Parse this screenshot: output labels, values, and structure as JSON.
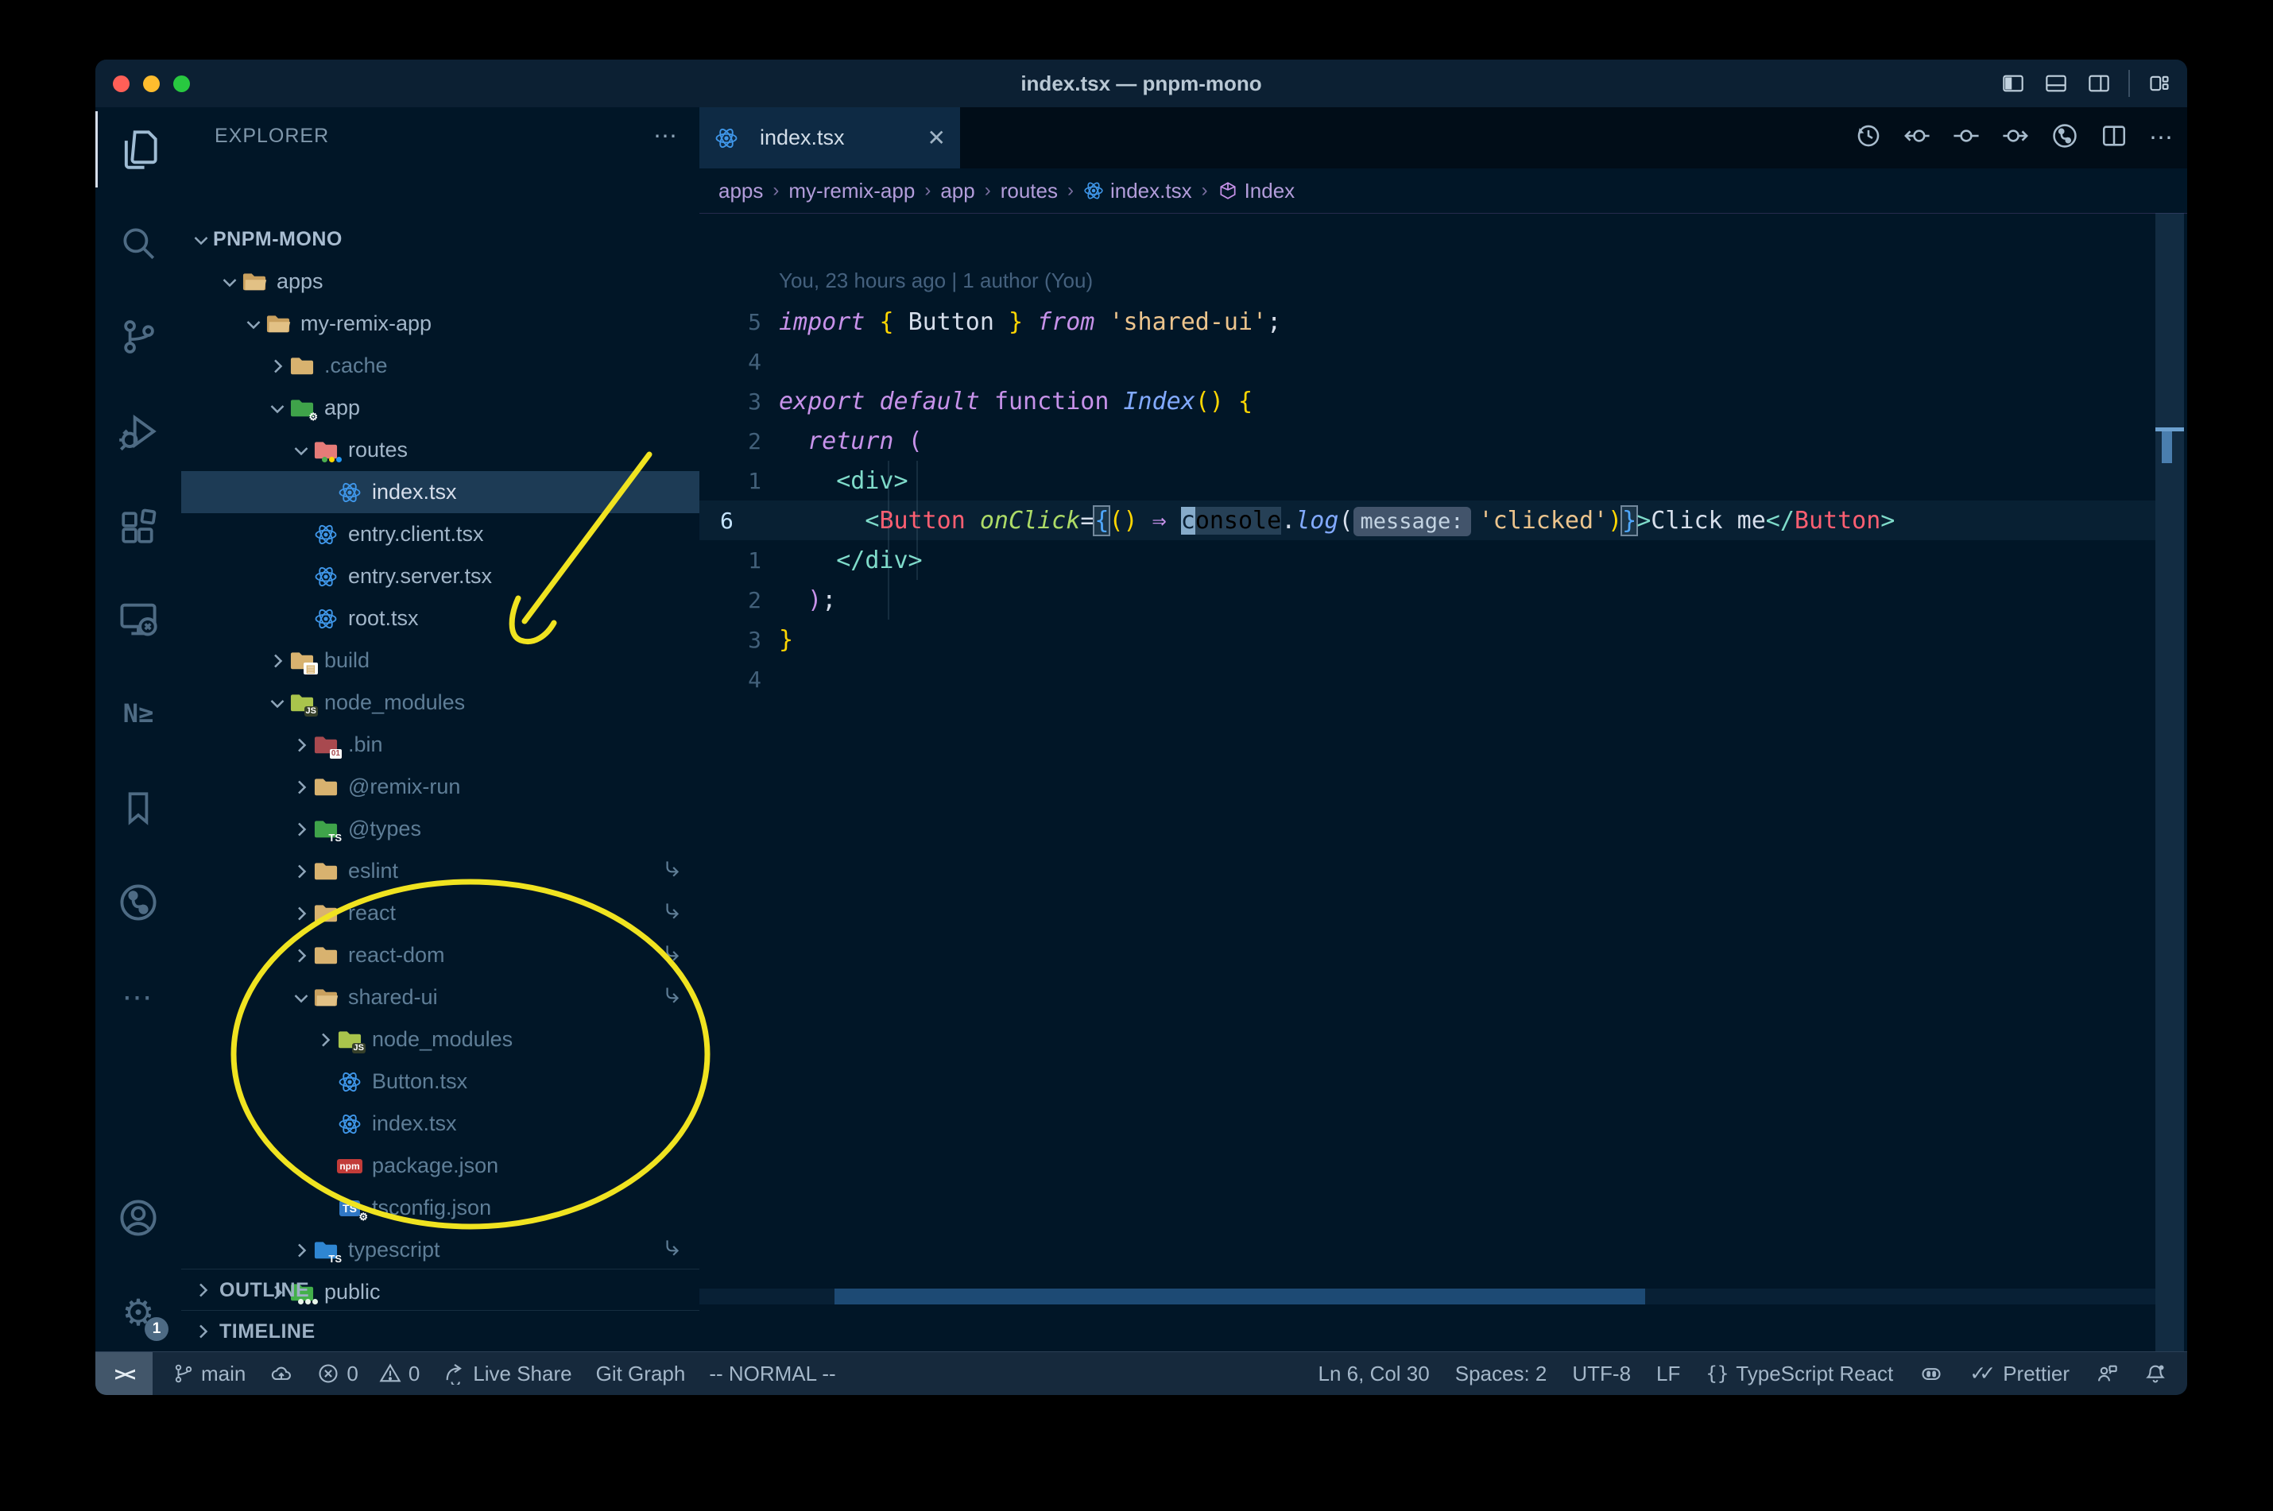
{
  "window": {
    "title": "index.tsx — pnpm-mono"
  },
  "titlebar": {
    "layout_icons": [
      "panel-left",
      "panel-bottom",
      "panel-right",
      "sep",
      "layout-custom"
    ]
  },
  "activity_bar": {
    "items": [
      {
        "name": "explorer",
        "active": true
      },
      {
        "name": "search"
      },
      {
        "name": "source-control"
      },
      {
        "name": "run-debug"
      },
      {
        "name": "extensions"
      },
      {
        "name": "remote-explorer"
      },
      {
        "name": "nx-console",
        "glyph": "N≥"
      },
      {
        "name": "bookmarks"
      },
      {
        "name": "git-graph"
      },
      {
        "name": "more"
      }
    ],
    "bottom_items": [
      {
        "name": "account"
      },
      {
        "name": "settings",
        "badge": "1"
      }
    ]
  },
  "sidebar": {
    "header": {
      "title": "EXPLORER",
      "more": "⋯"
    },
    "root": {
      "label": "PNPM-MONO"
    },
    "tree": [
      {
        "label": "apps",
        "depth": 1,
        "icon": "folder-open",
        "chevron": "down"
      },
      {
        "label": "my-remix-app",
        "depth": 2,
        "icon": "folder-open",
        "chevron": "down"
      },
      {
        "label": ".cache",
        "depth": 3,
        "icon": "folder",
        "chevron": "right",
        "dim": true
      },
      {
        "label": "app",
        "depth": 3,
        "icon": "folder-app",
        "chevron": "down"
      },
      {
        "label": "routes",
        "depth": 4,
        "icon": "folder-routes",
        "chevron": "down"
      },
      {
        "label": "index.tsx",
        "depth": 5,
        "icon": "react",
        "selected": true
      },
      {
        "label": "entry.client.tsx",
        "depth": 4,
        "icon": "react"
      },
      {
        "label": "entry.server.tsx",
        "depth": 4,
        "icon": "react"
      },
      {
        "label": "root.tsx",
        "depth": 4,
        "icon": "react"
      },
      {
        "label": "build",
        "depth": 3,
        "icon": "folder-dist",
        "chevron": "right",
        "dim": true
      },
      {
        "label": "node_modules",
        "depth": 3,
        "icon": "folder-js",
        "chevron": "down",
        "dim": true
      },
      {
        "label": ".bin",
        "depth": 4,
        "icon": "folder-bin",
        "chevron": "right",
        "dim": true
      },
      {
        "label": "@remix-run",
        "depth": 4,
        "icon": "folder",
        "chevron": "right",
        "dim": true
      },
      {
        "label": "@types",
        "depth": 4,
        "icon": "folder-ts-green",
        "chevron": "right",
        "dim": true
      },
      {
        "label": "eslint",
        "depth": 4,
        "icon": "folder",
        "chevron": "right",
        "dim": true,
        "symlink": true
      },
      {
        "label": "react",
        "depth": 4,
        "icon": "folder",
        "chevron": "right",
        "dim": true,
        "symlink": true
      },
      {
        "label": "react-dom",
        "depth": 4,
        "icon": "folder",
        "chevron": "right",
        "dim": true,
        "symlink": true
      },
      {
        "label": "shared-ui",
        "depth": 4,
        "icon": "folder-open",
        "chevron": "down",
        "dim": true,
        "symlink": true
      },
      {
        "label": "node_modules",
        "depth": 5,
        "icon": "folder-js",
        "chevron": "right",
        "dim": true
      },
      {
        "label": "Button.tsx",
        "depth": 5,
        "icon": "react",
        "dim": true
      },
      {
        "label": "index.tsx",
        "depth": 5,
        "icon": "react",
        "dim": true
      },
      {
        "label": "package.json",
        "depth": 5,
        "icon": "npm",
        "dim": true
      },
      {
        "label": "tsconfig.json",
        "depth": 5,
        "icon": "tsconfig",
        "dim": true
      },
      {
        "label": "typescript",
        "depth": 4,
        "icon": "folder-ts-blue",
        "chevron": "right",
        "dim": true,
        "symlink": true
      },
      {
        "label": "public",
        "depth": 3,
        "icon": "folder-public",
        "chevron": "right"
      }
    ],
    "sections": [
      "OUTLINE",
      "TIMELINE"
    ]
  },
  "tab": {
    "label": "index.tsx",
    "close": "✕"
  },
  "editor_toolbar": [
    "history",
    "commit-prev",
    "commit",
    "commit-next",
    "graph-circle",
    "split",
    "more"
  ],
  "breadcrumbs": [
    {
      "label": "apps"
    },
    {
      "label": "my-remix-app"
    },
    {
      "label": "app"
    },
    {
      "label": "routes"
    },
    {
      "label": "index.tsx",
      "icon": "react"
    },
    {
      "label": "Index",
      "icon": "symbol-module"
    }
  ],
  "editor": {
    "blame": "You, 23 hours ago | 1 author (You)",
    "lines": [
      {
        "gutter": "5",
        "tokens": [
          [
            "kw",
            "import"
          ],
          [
            "pl",
            " "
          ],
          [
            "gold",
            "{"
          ],
          [
            "pl",
            " "
          ],
          [
            "id",
            "Button"
          ],
          [
            "pl",
            " "
          ],
          [
            "gold",
            "}"
          ],
          [
            "pl",
            " "
          ],
          [
            "kw",
            "from"
          ],
          [
            "pl",
            " "
          ],
          [
            "str",
            "'shared-ui'"
          ],
          [
            "pl",
            ";"
          ]
        ]
      },
      {
        "gutter": "4",
        "tokens": []
      },
      {
        "gutter": "3",
        "tokens": [
          [
            "kw",
            "export"
          ],
          [
            "pl",
            " "
          ],
          [
            "kw",
            "default"
          ],
          [
            "pl",
            " "
          ],
          [
            "kw2",
            "function"
          ],
          [
            "pl",
            " "
          ],
          [
            "fn",
            "Index"
          ],
          [
            "gold",
            "()"
          ],
          [
            "pl",
            " "
          ],
          [
            "gold",
            "{"
          ]
        ]
      },
      {
        "gutter": "2",
        "tokens": [
          [
            "pl",
            "  "
          ],
          [
            "kw",
            "return"
          ],
          [
            "pl",
            " "
          ],
          [
            "mag",
            "("
          ]
        ]
      },
      {
        "gutter": "1",
        "tokens": [
          [
            "pl",
            "    "
          ],
          [
            "teal",
            "<div>"
          ]
        ]
      },
      {
        "gutter": "6",
        "current": true,
        "tokens": [
          [
            "pl",
            "      "
          ],
          [
            "teal",
            "<"
          ],
          [
            "cmp",
            "Button"
          ],
          [
            "pl",
            " "
          ],
          [
            "attr",
            "onClick"
          ],
          [
            "pl",
            "="
          ],
          [
            "boxb",
            "{"
          ],
          [
            "gold",
            "()"
          ],
          [
            "pl",
            " "
          ],
          [
            "mag",
            "⇒"
          ],
          [
            "pl",
            " "
          ],
          [
            "cur",
            "c"
          ],
          [
            "hl",
            "onsole"
          ],
          [
            "pl",
            "."
          ],
          [
            "fn",
            "log"
          ],
          [
            "pl",
            "("
          ],
          [
            "inlay",
            "message:"
          ],
          [
            "str",
            "'clicked'"
          ],
          [
            "gold",
            ")"
          ],
          [
            "boxb",
            "}"
          ],
          [
            "teal",
            ">"
          ],
          [
            "id",
            "Click me"
          ],
          [
            "teal",
            "</"
          ],
          [
            "cmp",
            "Button"
          ],
          [
            "teal",
            ">"
          ]
        ]
      },
      {
        "gutter": "1",
        "tokens": [
          [
            "pl",
            "    "
          ],
          [
            "teal",
            "</div>"
          ]
        ]
      },
      {
        "gutter": "2",
        "tokens": [
          [
            "pl",
            "  "
          ],
          [
            "mag",
            ")"
          ],
          [
            "pl",
            ";"
          ]
        ]
      },
      {
        "gutter": "3",
        "tokens": [
          [
            "gold",
            "}"
          ]
        ]
      },
      {
        "gutter": "4",
        "tokens": []
      }
    ]
  },
  "status_bar": {
    "left": [
      {
        "icon": "branch",
        "label": "main"
      },
      {
        "icon": "cloud-up",
        "label": ""
      },
      {
        "icon": "error",
        "label": "0",
        "icon2": "warning",
        "label2": "0"
      },
      {
        "icon": "share",
        "label": "Live Share"
      },
      {
        "label": "Git Graph"
      },
      {
        "label": "-- NORMAL --"
      }
    ],
    "remote_glyph": "><",
    "right": [
      {
        "label": "Ln 6, Col 30"
      },
      {
        "label": "Spaces: 2"
      },
      {
        "label": "UTF-8"
      },
      {
        "label": "LF"
      },
      {
        "icon": "braces",
        "label": "TypeScript React"
      },
      {
        "icon": "copilot",
        "label": ""
      },
      {
        "icon": "check-double",
        "label": "Prettier"
      },
      {
        "icon": "feedback",
        "label": ""
      },
      {
        "icon": "bell",
        "label": ""
      }
    ]
  },
  "annotations": {
    "color": "#f0e320"
  },
  "colors": {
    "desktop": "#000000",
    "editor_bg": "#011627",
    "titlebar_bg": "#0c2033",
    "statusbar_bg": "#16293c",
    "active_tab_bg": "#0e2a44",
    "selection_row_bg": "#1d3b55",
    "traffic_red": "#ff5f57",
    "traffic_yellow": "#febc2e",
    "traffic_green": "#28c840",
    "breadcrumb_text": "#b39ddb",
    "dim_text": "#5f7e97"
  }
}
